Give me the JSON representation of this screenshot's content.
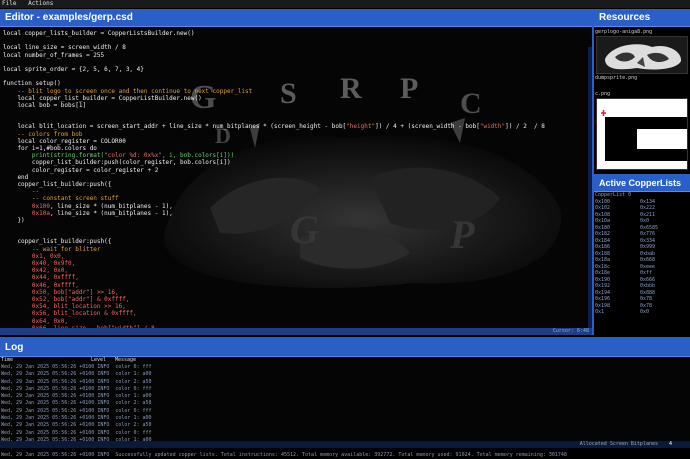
{
  "menu": [
    "File",
    "Actions"
  ],
  "editor": {
    "title": "Editor - examples/gerp.csd",
    "cursor": "Cursor: 6:48",
    "logo_letters": [
      "G",
      "S",
      "R",
      "P",
      "C",
      "D",
      "G",
      "P"
    ]
  },
  "code_lines": [
    [
      [
        "k",
        "local copper_lists_builder = CopperListsBuilder.new()"
      ]
    ],
    [],
    [
      [
        "k",
        "local line_size = screen_width / 8"
      ]
    ],
    [
      [
        "k",
        "local number_of_frames = 255"
      ]
    ],
    [],
    [
      [
        "k",
        "local sprite_order = {2, 5, 6, 7, 3, 4}"
      ]
    ],
    [],
    [
      [
        "k",
        "function setup()"
      ]
    ],
    [
      [
        "c",
        "    -- blit logo to screen once and then continue to next copper_list"
      ]
    ],
    [
      [
        "k",
        "    local copper_list_builder = CopperListBuilder.new()"
      ]
    ],
    [
      [
        "k",
        "    local bob = bobs[1]"
      ]
    ],
    [],
    [],
    [
      [
        "k",
        "    local blit_location = screen_start_addr + line_size * num_bitplanes * (screen_height - bob["
      ],
      [
        "str",
        "\"height\""
      ],
      [
        "k",
        "]) / 4 + (screen_width - bob["
      ],
      [
        "str",
        "\"width\""
      ],
      [
        "k",
        "]) / 2  / 8"
      ]
    ],
    [
      [
        "c",
        "    -- colors from bob"
      ]
    ],
    [
      [
        "k",
        "    local color_register = COLOR00"
      ]
    ],
    [
      [
        "k",
        "    for i=1,#bob.colors do"
      ]
    ],
    [
      [
        "g",
        "        print(string.format("
      ],
      [
        "str",
        "\"color %d: 0x%x\""
      ],
      [
        "g",
        ", i, bob.colors[i]))"
      ]
    ],
    [
      [
        "k",
        "        copper_list_builder:push(color_register, bob.colors[i])"
      ]
    ],
    [
      [
        "k",
        "        color_register = color_register + 2"
      ]
    ],
    [
      [
        "k",
        "    end"
      ]
    ],
    [
      [
        "k",
        "    copper_list_builder:push({"
      ]
    ],
    [
      [
        "c",
        "        --"
      ]
    ],
    [
      [
        "c",
        "        -- constant screen stuff"
      ]
    ],
    [
      [
        "r",
        "        0x100"
      ],
      [
        "k",
        ", line_size * (num_bitplanes - 1),"
      ]
    ],
    [
      [
        "r",
        "        0x10a"
      ],
      [
        "k",
        ", line_size * (num_bitplanes - 1),"
      ]
    ],
    [
      [
        "k",
        "    })"
      ]
    ],
    [],
    [],
    [
      [
        "k",
        "    copper_list_builder:push({"
      ]
    ],
    [
      [
        "c",
        "        -- wait for blitter"
      ]
    ],
    [
      [
        "r",
        "        0x1, 0x0,"
      ]
    ],
    [
      [
        "r",
        "        0x40, 0x9f0,"
      ]
    ],
    [
      [
        "r",
        "        0x42, 0x0,"
      ]
    ],
    [
      [
        "r",
        "        0x44, 0xffff,"
      ]
    ],
    [
      [
        "r",
        "        0x46, 0xffff,"
      ]
    ],
    [
      [
        "r",
        "        0x50, bob["
      ],
      [
        "str",
        "\"addr\""
      ],
      [
        "r",
        "] >> 16,"
      ]
    ],
    [
      [
        "r",
        "        0x52, bob["
      ],
      [
        "str",
        "\"addr\""
      ],
      [
        "r",
        "] & 0xffff,"
      ]
    ],
    [
      [
        "r",
        "        0x54, blit_location >> 16,"
      ]
    ],
    [
      [
        "r",
        "        0x56, blit_location & 0xffff,"
      ]
    ],
    [
      [
        "r",
        "        0x64, 0x0,"
      ]
    ],
    [
      [
        "r",
        "        0x66, line_size - bob["
      ],
      [
        "str",
        "\"width\""
      ],
      [
        "r",
        "] / 8,"
      ]
    ]
  ],
  "resources": {
    "title": "Resources",
    "items": [
      "gerplogo-aniga8.png",
      "dumpsprite.png",
      "c.png"
    ]
  },
  "copper": {
    "title": "Active CopperLists",
    "list_title": "CopperList 0",
    "rows": [
      [
        "0x100",
        "0x134"
      ],
      [
        "0x102",
        "0x222"
      ],
      [
        "0x108",
        "0x211"
      ],
      [
        "0x10a",
        "0x0"
      ],
      [
        "0x180",
        "0x6585"
      ],
      [
        "0x182",
        "0x776"
      ],
      [
        "0x184",
        "0x334"
      ],
      [
        "0x186",
        "0x999"
      ],
      [
        "0x188",
        "0xbab"
      ],
      [
        "0x18a",
        "0x668"
      ],
      [
        "0x18c",
        "0xeee"
      ],
      [
        "0x18e",
        "0xff"
      ],
      [
        "0x190",
        "0x666"
      ],
      [
        "0x192",
        "0xbbb"
      ],
      [
        "0x194",
        "0x888"
      ],
      [
        "0x196",
        "0x78"
      ],
      [
        "0x198",
        "0x78"
      ],
      [
        "0x1",
        "0x0"
      ]
    ]
  },
  "log": {
    "title": "Log",
    "columns": [
      "Time",
      "Level",
      "Message"
    ],
    "rows": [
      "Wed, 29 Jan 2025 05:56:26 +0100 INFO  color 0: fff",
      "Wed, 29 Jan 2025 05:56:26 +0100 INFO  color 1: a00",
      "Wed, 29 Jan 2025 05:56:26 +0100 INFO  color 2: a50",
      "Wed, 29 Jan 2025 05:56:26 +0100 INFO  color 0: fff",
      "Wed, 29 Jan 2025 05:56:26 +0100 INFO  color 1: a00",
      "Wed, 29 Jan 2025 05:56:26 +0100 INFO  color 2: a50",
      "Wed, 29 Jan 2025 05:56:26 +0100 INFO  color 0: fff",
      "Wed, 29 Jan 2025 05:56:26 +0100 INFO  color 1: a00",
      "Wed, 29 Jan 2025 05:56:26 +0100 INFO  color 2: a50",
      "Wed, 29 Jan 2025 05:56:26 +0100 INFO  color 0: fff",
      "Wed, 29 Jan 2025 05:56:26 +0100 INFO  color 1: a00",
      "Wed, 29 Jan 2025 05:56:26 +0100 INFO  color 2: a50",
      "Wed, 29 Jan 2025 05:56:26 +0100 INFO  Successfully updated copper lists. Total instructions: 45512. Total memory available: 392772. Total memory used: 91024. Total memory remaining: 301748"
    ]
  },
  "status": {
    "label": "Allocated Screen Bitplanes",
    "value": "4"
  },
  "colors": {
    "accent": "#2a5fc8",
    "background": "#000000"
  }
}
